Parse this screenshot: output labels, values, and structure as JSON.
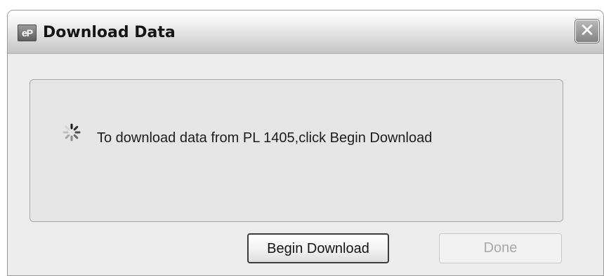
{
  "window": {
    "title": "Download Data",
    "app_icon": "eP",
    "close_label": "✕"
  },
  "content": {
    "message": "To download data from PL 1405,click Begin Download",
    "status_icon": "spinner-icon"
  },
  "buttons": {
    "begin_label": "Begin Download",
    "done_label": "Done",
    "done_enabled": false
  },
  "colors": {
    "window_bg": "#ececec",
    "group_bg": "#e5e5e5",
    "disabled_text": "#a8a8a8"
  }
}
